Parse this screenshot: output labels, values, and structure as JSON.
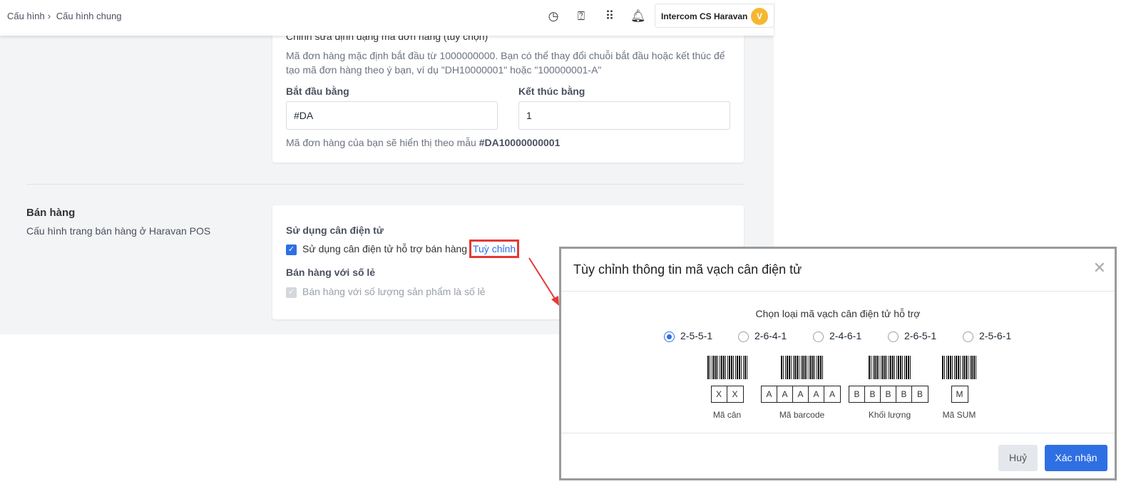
{
  "header": {
    "breadcrumb": [
      "Cấu hình",
      "Cấu hình chung"
    ],
    "user_name": "Intercom CS Haravan",
    "avatar_initial": "V"
  },
  "order_card": {
    "title": "Chỉnh sửa định dạng mã đơn hàng (tùy chọn)",
    "description": "Mã đơn hàng mặc định bắt đầu từ 1000000000. Bạn có thể thay đổi chuỗi bắt đầu hoặc kết thúc để tạo mã đơn hàng theo ý bạn, ví dụ \"DH10000001\" hoặc \"100000001-A\"",
    "start_label": "Bắt đầu bằng",
    "start_value": "#DA",
    "end_label": "Kết thúc bằng",
    "end_value": "1",
    "preview_text": "Mã đơn hàng của bạn sẽ hiển thị theo mẫu",
    "preview_value": "#DA10000000001"
  },
  "sales": {
    "title": "Bán hàng",
    "subtitle": "Cấu hình trang bán hàng ở Haravan POS",
    "scale_heading": "Sử dụng cân điện tử",
    "scale_checkbox": "Sử dụng cân điện tử hỗ trợ bán hàng",
    "customize_link": "Tuỳ chỉnh",
    "decimal_heading": "Bán hàng với số lẻ",
    "decimal_checkbox": "Bán hàng với số lượng sản phẩm là số lẻ"
  },
  "modal": {
    "title": "Tùy chỉnh thông tin mã vạch cân điện tử",
    "prompt": "Chọn loại mã vạch cân điện tử hỗ trợ",
    "options": [
      "2-5-5-1",
      "2-6-4-1",
      "2-4-6-1",
      "2-6-5-1",
      "2-5-6-1"
    ],
    "selected": "2-5-5-1",
    "groups": [
      {
        "chars": [
          "X",
          "X"
        ],
        "caption": "Mã cân"
      },
      {
        "chars": [
          "A",
          "A",
          "A",
          "A",
          "A"
        ],
        "caption": "Mã barcode"
      },
      {
        "chars": [
          "B",
          "B",
          "B",
          "B",
          "B"
        ],
        "caption": "Khối lượng"
      },
      {
        "chars": [
          "M"
        ],
        "caption": "Mã SUM"
      }
    ],
    "cancel": "Huỷ",
    "confirm": "Xác nhận"
  },
  "colors": {
    "primary": "#2f6fe4",
    "highlight": "#e53935"
  }
}
